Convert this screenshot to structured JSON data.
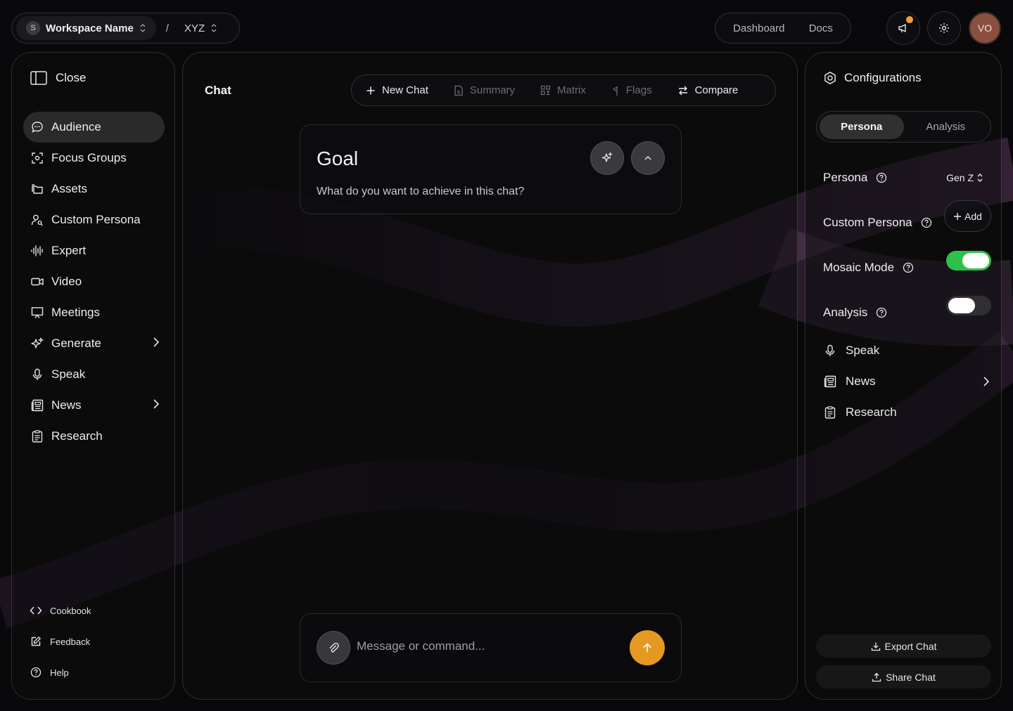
{
  "topbar": {
    "workspace_initial": "S",
    "workspace_name": "Workspace Name",
    "separator": "/",
    "project": "XYZ",
    "links": [
      "Dashboard",
      "Docs"
    ],
    "avatar_initials": "VO",
    "notification_dot_color": "#f0a030",
    "avatar_color": "#8a4f3f"
  },
  "sidebar": {
    "close_label": "Close",
    "items": [
      {
        "label": "Audience",
        "icon": "chat-bubble-icon",
        "active": true
      },
      {
        "label": "Focus Groups",
        "icon": "focus-icon"
      },
      {
        "label": "Assets",
        "icon": "folders-icon"
      },
      {
        "label": "Custom Persona",
        "icon": "user-search-icon"
      },
      {
        "label": "Expert",
        "icon": "waveform-icon"
      },
      {
        "label": "Video",
        "icon": "video-icon"
      },
      {
        "label": "Meetings",
        "icon": "presentation-icon"
      },
      {
        "label": "Generate",
        "icon": "sparkles-icon",
        "submenu": true
      },
      {
        "label": "Speak",
        "icon": "microphone-icon"
      },
      {
        "label": "News",
        "icon": "newspaper-icon",
        "submenu": true
      },
      {
        "label": "Research",
        "icon": "clipboard-icon"
      }
    ],
    "footer": [
      {
        "label": "Cookbook",
        "icon": "code-icon"
      },
      {
        "label": "Feedback",
        "icon": "edit-icon"
      },
      {
        "label": "Help",
        "icon": "help-circle-icon"
      }
    ]
  },
  "main": {
    "title": "Chat",
    "toolbar": [
      {
        "label": "New Chat",
        "icon": "plus-icon",
        "enabled": true
      },
      {
        "label": "Summary",
        "icon": "document-icon",
        "enabled": false
      },
      {
        "label": "Matrix",
        "icon": "grid-icon",
        "enabled": false
      },
      {
        "label": "Flags",
        "icon": "flag-icon",
        "enabled": false
      },
      {
        "label": "Compare",
        "icon": "swap-icon",
        "enabled": true
      }
    ],
    "goal": {
      "title": "Goal",
      "subtitle": "What do you want to achieve in this chat?"
    },
    "composer": {
      "placeholder": "Message or command...",
      "send_color": "#e49a22"
    }
  },
  "config": {
    "title": "Configurations",
    "tabs": [
      {
        "label": "Persona",
        "active": true
      },
      {
        "label": "Analysis",
        "active": false
      }
    ],
    "persona_label": "Persona",
    "persona_value": "Gen Z",
    "custom_persona_label": "Custom Persona",
    "add_label": "Add",
    "mosaic_label": "Mosaic Mode",
    "mosaic_on": true,
    "analysis_label": "Analysis",
    "analysis_on": false,
    "toggle_on_color": "#2fc04a",
    "links": [
      {
        "label": "Speak",
        "icon": "microphone-icon"
      },
      {
        "label": "News",
        "icon": "newspaper-icon",
        "submenu": true
      },
      {
        "label": "Research",
        "icon": "clipboard-icon"
      }
    ],
    "export_label": "Export Chat",
    "share_label": "Share Chat"
  }
}
